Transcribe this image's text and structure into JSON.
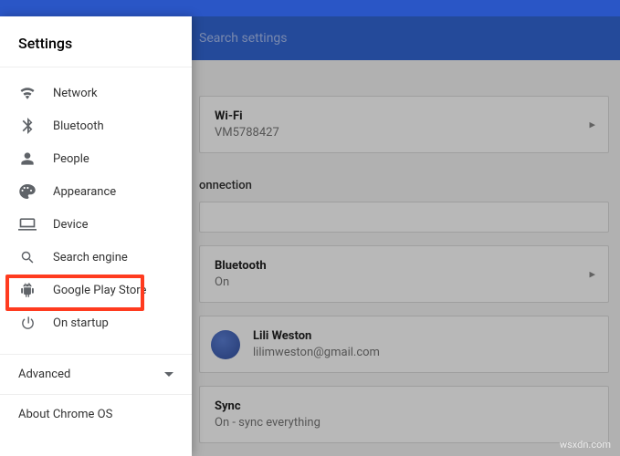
{
  "header": {
    "search_placeholder": "Search settings"
  },
  "sidebar": {
    "title": "Settings",
    "items": [
      {
        "label": "Network"
      },
      {
        "label": "Bluetooth"
      },
      {
        "label": "People"
      },
      {
        "label": "Appearance"
      },
      {
        "label": "Device"
      },
      {
        "label": "Search engine"
      },
      {
        "label": "Google Play Store"
      },
      {
        "label": "On startup"
      }
    ],
    "advanced_label": "Advanced",
    "about_label": "About Chrome OS"
  },
  "main": {
    "sections": {
      "wifi": {
        "title": "Wi-Fi",
        "sub": "VM5788427"
      },
      "connection_header": "onnection",
      "bluetooth": {
        "title": "Bluetooth",
        "sub": "On"
      },
      "people": {
        "name": "Lili Weston",
        "email": "lilimweston@gmail.com"
      },
      "sync": {
        "title": "Sync",
        "sub": "On - sync everything"
      }
    }
  },
  "watermark": "wsxdn.com"
}
